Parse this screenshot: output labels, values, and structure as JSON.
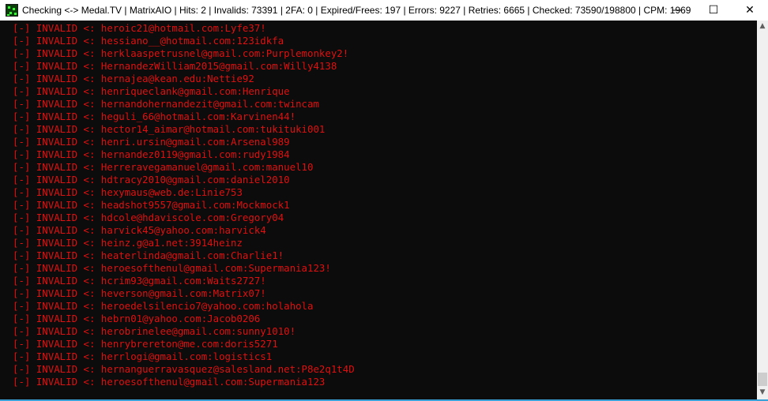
{
  "window": {
    "title": "Checking <-> Medal.TV | MatrixAIO | Hits: 2 | Invalids: 73391 | 2FA: 0 | Expired/Frees: 197 | Errors: 9227 | Retries: 6665 | Checked: 73590/198800 | CPM: 1969",
    "minimize": "—",
    "maximize": "☐",
    "close": "✕"
  },
  "console": {
    "text_color": "#e01010",
    "background": "#0c0c0c",
    "lines": [
      "[-] INVALID <: heroic21@hotmail.com:Lyfe37!",
      "[-] INVALID <: hessiano__@hotmail.com:123idkfa",
      "[-] INVALID <: herklaaspetrusnel@gmail.com:Purplemonkey2!",
      "[-] INVALID <: HernandezWilliam2015@gmail.com:Willy4138",
      "[-] INVALID <: hernajea@kean.edu:Nettie92",
      "[-] INVALID <: henriqueclank@gmail.com:Henrique",
      "[-] INVALID <: hernandohernandezit@gmail.com:twincam",
      "[-] INVALID <: heguli_66@hotmail.com:Karvinen44!",
      "[-] INVALID <: hector14_aimar@hotmail.com:tukituki001",
      "[-] INVALID <: henri.ursin@gmail.com:Arsenal989",
      "[-] INVALID <: hernandez0119@gmail.com:rudy1984",
      "[-] INVALID <: Herreravegamanuel@gmail.com:manuel10",
      "[-] INVALID <: hdtracy2010@gmail.com:daniel2010",
      "[-] INVALID <: hexymaus@web.de:Linie753",
      "[-] INVALID <: headshot9557@gmail.com:Mockmock1",
      "[-] INVALID <: hdcole@hdaviscole.com:Gregory04",
      "[-] INVALID <: harvick45@yahoo.com:harvick4",
      "[-] INVALID <: heinz.g@a1.net:3914heinz",
      "[-] INVALID <: heaterlinda@gmail.com:Charlie1!",
      "[-] INVALID <: heroesofthenul@gmail.com:Supermania123!",
      "[-] INVALID <: hcrim93@gmail.com:Waits2727!",
      "[-] INVALID <: heverson@gmail.com:Matrix07!",
      "[-] INVALID <: heroedelsilencio7@yahoo.com:holahola",
      "[-] INVALID <: hebrn01@yahoo.com:Jacob0206",
      "[-] INVALID <: herobrinelee@gmail.com:sunny1010!",
      "[-] INVALID <: henrybrereton@me.com:doris5271",
      "[-] INVALID <: herrlogi@gmail.com:logistics1",
      "[-] INVALID <: hernanguerravasquez@salesland.net:P8e2q1t4D",
      "[-] INVALID <: heroesofthenul@gmail.com:Supermania123"
    ]
  },
  "scrollbar": {
    "position_fraction": 0.97,
    "up": "^",
    "down": "v"
  }
}
